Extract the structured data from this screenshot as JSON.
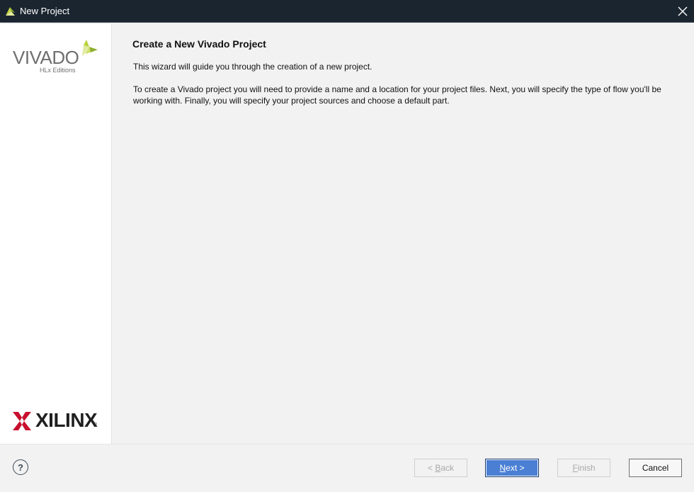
{
  "window": {
    "title": "New Project",
    "app_icon": "vivado-leaf-icon",
    "close_icon": "close-icon"
  },
  "sidebar": {
    "brand_top": "VIVADO",
    "brand_top_sub": "HLx Editions",
    "brand_bottom": "XILINX",
    "brand_bottom_mark": "®"
  },
  "main": {
    "heading": "Create a New Vivado Project",
    "intro": "This wizard will guide you through the creation of a new project.",
    "details": "To create a Vivado project you will need to provide a name and a location for your project files. Next, you will specify the type of flow you'll be working with. Finally, you will specify your project sources and choose a default part."
  },
  "footer": {
    "help_label": "?",
    "back": {
      "prefix": "< ",
      "mnemonic": "B",
      "rest": "ack",
      "enabled": false
    },
    "next": {
      "prefix": "",
      "mnemonic": "N",
      "rest": "ext >",
      "enabled": true
    },
    "finish": {
      "prefix": "",
      "mnemonic": "F",
      "rest": "inish",
      "enabled": false
    },
    "cancel": {
      "label": "Cancel",
      "enabled": true
    }
  },
  "colors": {
    "titlebar_bg": "#1b2530",
    "primary_button": "#4a7fd4",
    "xilinx_red": "#c8102e",
    "vivado_green": "#a6c23a"
  }
}
